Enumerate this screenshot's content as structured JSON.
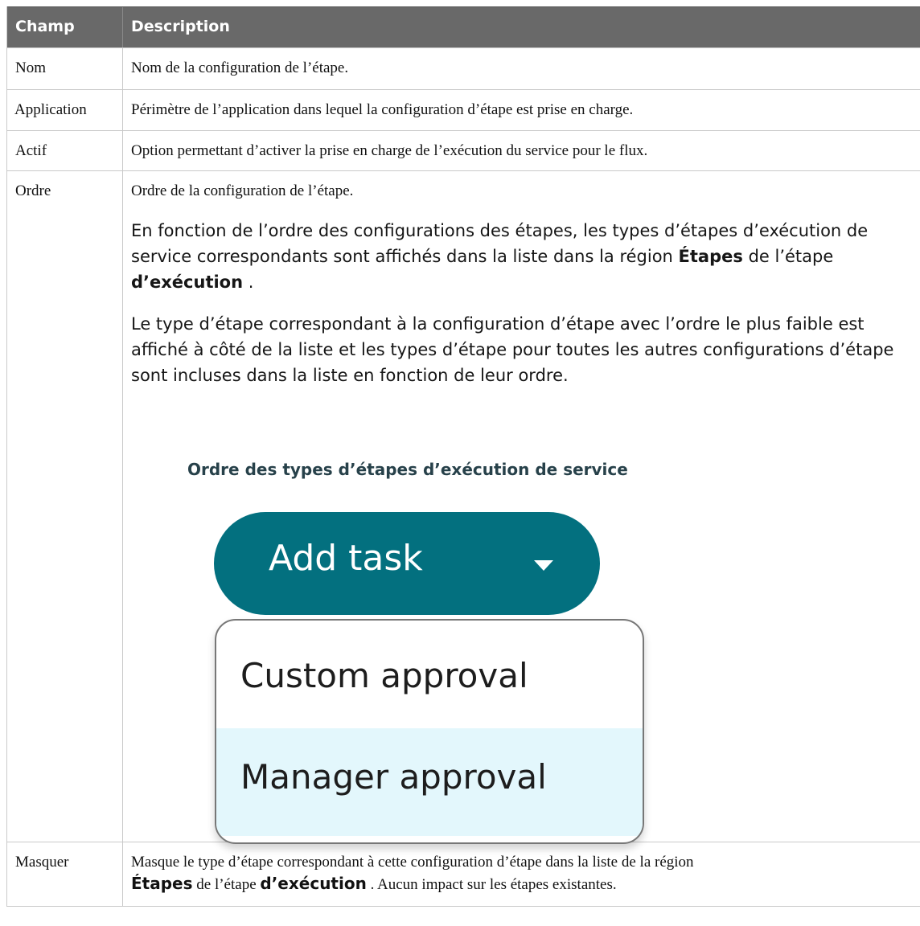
{
  "table": {
    "headers": {
      "field": "Champ",
      "description": "Description"
    },
    "rows": [
      {
        "field": "Nom",
        "description": "Nom de la configuration de l’étape."
      },
      {
        "field": "Application",
        "description": "Périmètre de l’application dans lequel la configuration d’étape est prise en charge."
      },
      {
        "field": "Actif",
        "description": "Option permettant d’activer la prise en charge de l’exécution du service pour le flux."
      },
      {
        "field": "Ordre",
        "description": "Ordre de la configuration de l’étape.",
        "para1_a": "En fonction de l’ordre des configurations des étapes, les types d’étapes d’exécution de service correspondants sont affichés dans la liste dans la région ",
        "para1_b1": "Étapes",
        "para1_mid": " de l’étape ",
        "para1_b2": "d’exécution",
        "para1_end": " .",
        "para2": "Le type d’étape correspondant à la configuration d’étape avec l’ordre le plus faible est affiché à côté de la liste et les types d’étape pour toutes les autres configurations d’étape sont incluses dans la liste en fonction de leur ordre.",
        "figure_title": "Ordre des types d’étapes d’exécution de service",
        "figure": {
          "button_label": "Add task",
          "menu_items": [
            "Custom approval",
            "Manager approval"
          ],
          "colors": {
            "button": "#03707f",
            "highlight": "#e3f7fc"
          }
        }
      },
      {
        "field": "Masquer",
        "desc_a": "Masque le type d’étape correspondant à cette configuration d’étape dans la liste de la région",
        "desc_b1": "Étapes",
        "desc_mid": " de l’étape ",
        "desc_b2": "d’exécution",
        "desc_end": " . Aucun impact sur les étapes existantes."
      }
    ]
  }
}
